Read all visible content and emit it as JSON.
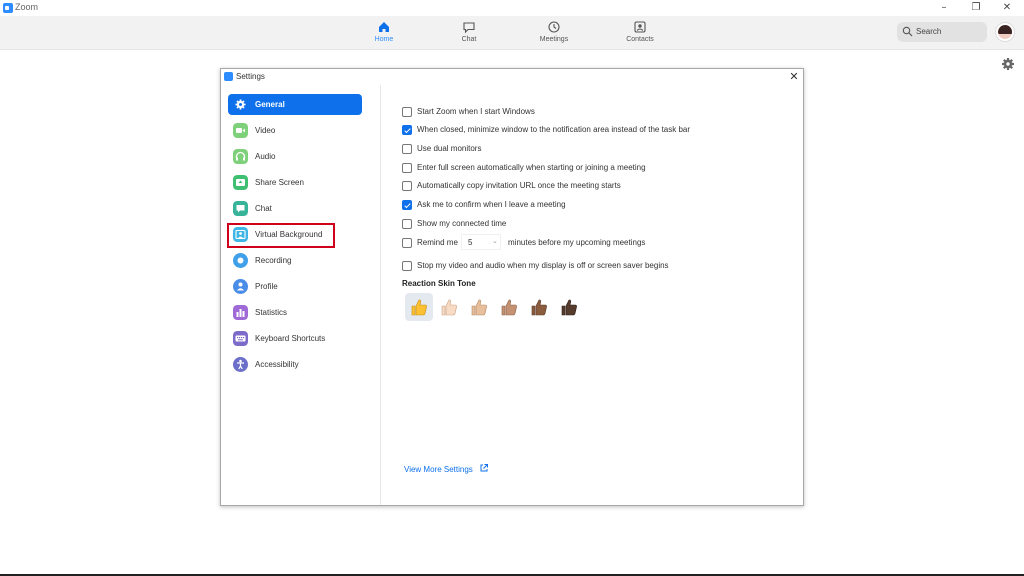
{
  "window": {
    "title": "Zoom",
    "controls": [
      "–",
      "❐",
      "✕"
    ]
  },
  "nav": {
    "tabs": [
      {
        "label": "Home",
        "icon": "home-icon",
        "active": true
      },
      {
        "label": "Chat",
        "icon": "chat-icon",
        "active": false
      },
      {
        "label": "Meetings",
        "icon": "clock-icon",
        "active": false
      },
      {
        "label": "Contacts",
        "icon": "contacts-icon",
        "active": false
      }
    ],
    "search_placeholder": "Search"
  },
  "settings": {
    "title": "Settings",
    "close": "✕",
    "sidebar": [
      {
        "label": "General",
        "icon": "gear-icon",
        "color": "#ffffff",
        "active": true
      },
      {
        "label": "Video",
        "icon": "video-icon",
        "color": "#7ed07a"
      },
      {
        "label": "Audio",
        "icon": "headphones-icon",
        "color": "#7ed07a"
      },
      {
        "label": "Share Screen",
        "icon": "share-screen-icon",
        "color": "#3fbf71"
      },
      {
        "label": "Chat",
        "icon": "chat-icon",
        "color": "#37b39a"
      },
      {
        "label": "Virtual Background",
        "icon": "virtual-background-icon",
        "color": "#3fb6e6"
      },
      {
        "label": "Recording",
        "icon": "recording-icon",
        "color": "#3f9fe8"
      },
      {
        "label": "Profile",
        "icon": "profile-icon",
        "color": "#4a8de8"
      },
      {
        "label": "Statistics",
        "icon": "statistics-icon",
        "color": "#a06ad6"
      },
      {
        "label": "Keyboard Shortcuts",
        "icon": "keyboard-icon",
        "color": "#7d6bc9"
      },
      {
        "label": "Accessibility",
        "icon": "accessibility-icon",
        "color": "#6c6fc9"
      }
    ],
    "options": [
      {
        "label": "Start Zoom when I start Windows",
        "checked": false
      },
      {
        "label": "When closed, minimize window to the notification area instead of the task bar",
        "checked": true
      },
      {
        "label": "Use dual monitors",
        "checked": false
      },
      {
        "label": "Enter full screen automatically when starting or joining a meeting",
        "checked": false
      },
      {
        "label": "Automatically copy invitation URL once the meeting starts",
        "checked": false
      },
      {
        "label": "Ask me to confirm when I leave a meeting",
        "checked": true
      },
      {
        "label": "Show my connected time",
        "checked": false
      }
    ],
    "remind": {
      "label": "Remind me",
      "value": "5",
      "suffix": "minutes before my upcoming meetings",
      "checked": false
    },
    "stop_video": {
      "label": "Stop my video and audio when my display is off or screen saver begins",
      "checked": false
    },
    "skin_tone": {
      "title": "Reaction Skin Tone",
      "tones": [
        "#fdc033",
        "#f7dbc4",
        "#e8bf9c",
        "#c49273",
        "#8c5c3f",
        "#563c2d"
      ],
      "selected_index": 0
    },
    "view_more": "View More Settings"
  }
}
